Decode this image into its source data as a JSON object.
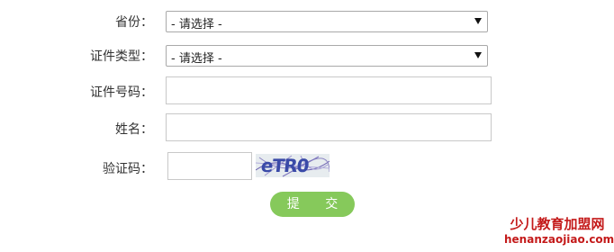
{
  "form": {
    "province": {
      "label": "省份：",
      "selected": "- 请选择 -"
    },
    "id_type": {
      "label": "证件类型：",
      "selected": "- 请选择 -"
    },
    "id_number": {
      "label": "证件号码：",
      "value": ""
    },
    "name": {
      "label": "姓名：",
      "value": ""
    },
    "captcha": {
      "label": "验证码：",
      "value": "",
      "image_text": "eTR0"
    },
    "submit_label": "提 交"
  },
  "watermark": {
    "title": "少儿教育加盟网",
    "url": "henanzaojiao.com"
  },
  "colors": {
    "submit_bg": "#86c95b",
    "watermark": "#c41a1a",
    "captcha_text": "#3a4aa8"
  }
}
